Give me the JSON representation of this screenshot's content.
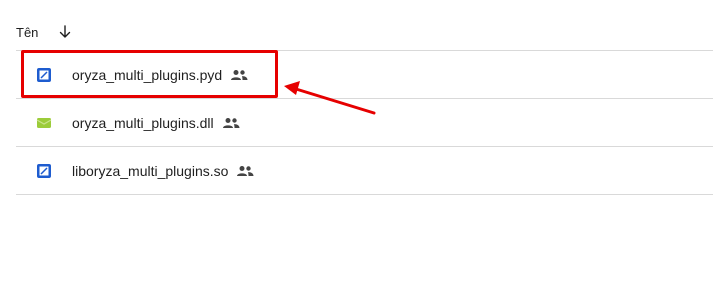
{
  "header": {
    "column_label": "Tên",
    "sort_icon": "arrow-down-icon"
  },
  "files": [
    {
      "name": "oryza_multi_plugins.pyd",
      "icon": "blue-file-icon",
      "shared_icon": "people-icon",
      "highlighted": true
    },
    {
      "name": "oryza_multi_plugins.dll",
      "icon": "green-file-icon",
      "shared_icon": "people-icon",
      "highlighted": false
    },
    {
      "name": "liboryza_multi_plugins.so",
      "icon": "blue-file-icon",
      "shared_icon": "people-icon",
      "highlighted": false
    }
  ],
  "colors": {
    "annotation_red": "#e60000",
    "blue_icon": "#1e5ccf",
    "green_icon": "#9ccc3a"
  }
}
